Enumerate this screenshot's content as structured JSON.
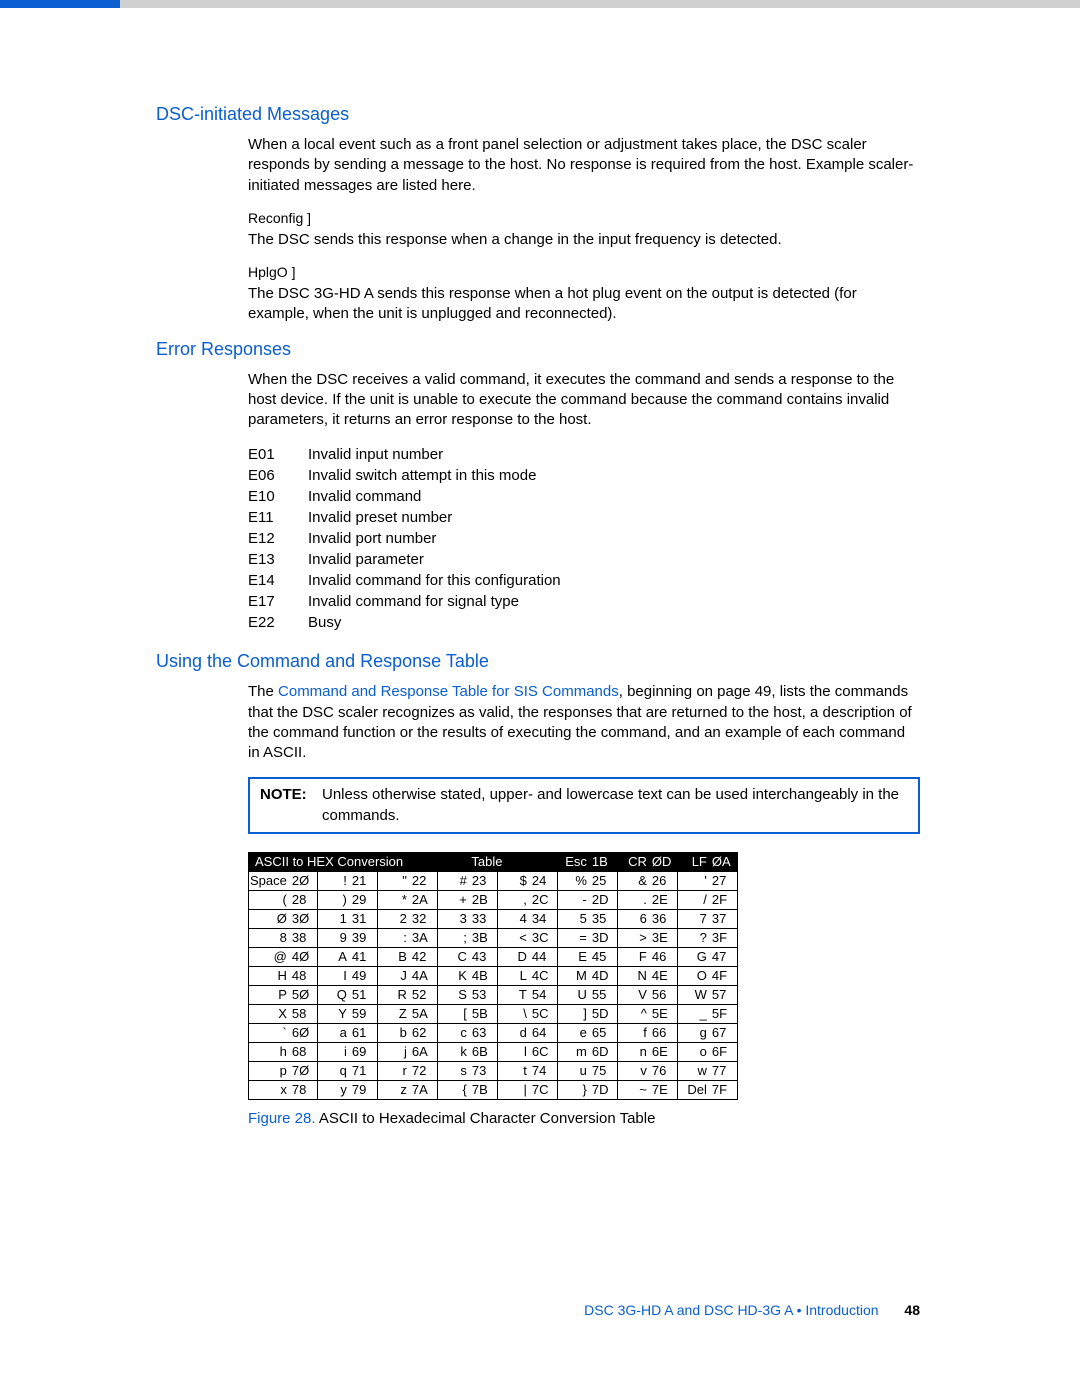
{
  "sections": {
    "dsc": {
      "heading": "DSC-initiated Messages",
      "intro": "When a local event such as a front panel selection or adjustment takes place, the DSC scaler responds by sending a message to the host. No response is required from the host. Example scaler-initiated messages are listed here.",
      "reconfig_label": "Reconfig ]",
      "reconfig_desc": "The DSC sends this response when a change in the input frequency is detected.",
      "hplg_label": "HplgO ]",
      "hplg_desc": "The DSC 3G-HD A sends this response when a hot plug event on the output is detected (for example, when the unit is unplugged and reconnected)."
    },
    "errors": {
      "heading": "Error Responses",
      "intro": "When the DSC receives a valid command, it executes the command and sends a response to the host device. If the unit is unable to execute the command because the command contains invalid parameters, it returns an error response to the host.",
      "codes": [
        {
          "c": "E01",
          "d": "Invalid input number"
        },
        {
          "c": "E06",
          "d": "Invalid switch attempt in this mode"
        },
        {
          "c": "E10",
          "d": "Invalid command"
        },
        {
          "c": "E11",
          "d": "Invalid preset number"
        },
        {
          "c": "E12",
          "d": "Invalid port number"
        },
        {
          "c": "E13",
          "d": "Invalid parameter"
        },
        {
          "c": "E14",
          "d": "Invalid command for this configuration"
        },
        {
          "c": "E17",
          "d": "Invalid command for signal type"
        },
        {
          "c": "E22",
          "d": "Busy"
        }
      ]
    },
    "using": {
      "heading": "Using the Command and Response Table",
      "intro_prefix": "The ",
      "intro_link": "Command and Response Table for SIS Commands",
      "intro_suffix": ", beginning on page 49, lists the commands that the DSC scaler recognizes as valid, the responses that are returned to the host, a description of the command function or the results of executing the command, and an example of each command in ASCII.",
      "note_label": "NOTE:",
      "note_text": "Unless otherwise stated, upper- and lowercase text can be used interchangeably in the commands."
    }
  },
  "chart_data": {
    "type": "table",
    "title": "ASCII to HEX Conversion Table",
    "header_left": "ASCII to HEX Conversion",
    "header_right": "Table",
    "header_suffix": [
      [
        "Esc",
        "1B"
      ],
      [
        "CR",
        "ØD"
      ],
      [
        "LF",
        "ØA"
      ]
    ],
    "rows": [
      [
        [
          "Space",
          "2Ø"
        ],
        [
          "!",
          "21"
        ],
        [
          "\"",
          "22"
        ],
        [
          "#",
          "23"
        ],
        [
          "$",
          "24"
        ],
        [
          "%",
          "25"
        ],
        [
          "&",
          "26"
        ],
        [
          "'",
          "27"
        ]
      ],
      [
        [
          "(",
          "28"
        ],
        [
          ")",
          "29"
        ],
        [
          "*",
          "2A"
        ],
        [
          "+",
          "2B"
        ],
        [
          ",",
          "2C"
        ],
        [
          "-",
          "2D"
        ],
        [
          ".",
          "2E"
        ],
        [
          "/",
          "2F"
        ]
      ],
      [
        [
          "Ø",
          "3Ø"
        ],
        [
          "1",
          "31"
        ],
        [
          "2",
          "32"
        ],
        [
          "3",
          "33"
        ],
        [
          "4",
          "34"
        ],
        [
          "5",
          "35"
        ],
        [
          "6",
          "36"
        ],
        [
          "7",
          "37"
        ]
      ],
      [
        [
          "8",
          "38"
        ],
        [
          "9",
          "39"
        ],
        [
          ":",
          "3A"
        ],
        [
          ";",
          "3B"
        ],
        [
          "<",
          "3C"
        ],
        [
          "=",
          "3D"
        ],
        [
          ">",
          "3E"
        ],
        [
          "?",
          "3F"
        ]
      ],
      [
        [
          "@",
          "4Ø"
        ],
        [
          "A",
          "41"
        ],
        [
          "B",
          "42"
        ],
        [
          "C",
          "43"
        ],
        [
          "D",
          "44"
        ],
        [
          "E",
          "45"
        ],
        [
          "F",
          "46"
        ],
        [
          "G",
          "47"
        ]
      ],
      [
        [
          "H",
          "48"
        ],
        [
          "I",
          "49"
        ],
        [
          "J",
          "4A"
        ],
        [
          "K",
          "4B"
        ],
        [
          "L",
          "4C"
        ],
        [
          "M",
          "4D"
        ],
        [
          "N",
          "4E"
        ],
        [
          "O",
          "4F"
        ]
      ],
      [
        [
          "P",
          "5Ø"
        ],
        [
          "Q",
          "51"
        ],
        [
          "R",
          "52"
        ],
        [
          "S",
          "53"
        ],
        [
          "T",
          "54"
        ],
        [
          "U",
          "55"
        ],
        [
          "V",
          "56"
        ],
        [
          "W",
          "57"
        ]
      ],
      [
        [
          "X",
          "58"
        ],
        [
          "Y",
          "59"
        ],
        [
          "Z",
          "5A"
        ],
        [
          "[",
          "5B"
        ],
        [
          "\\",
          "5C"
        ],
        [
          "]",
          "5D"
        ],
        [
          "^",
          "5E"
        ],
        [
          "_",
          "5F"
        ]
      ],
      [
        [
          "`",
          "6Ø"
        ],
        [
          "a",
          "61"
        ],
        [
          "b",
          "62"
        ],
        [
          "c",
          "63"
        ],
        [
          "d",
          "64"
        ],
        [
          "e",
          "65"
        ],
        [
          "f",
          "66"
        ],
        [
          "g",
          "67"
        ]
      ],
      [
        [
          "h",
          "68"
        ],
        [
          "i",
          "69"
        ],
        [
          "j",
          "6A"
        ],
        [
          "k",
          "6B"
        ],
        [
          "l",
          "6C"
        ],
        [
          "m",
          "6D"
        ],
        [
          "n",
          "6E"
        ],
        [
          "o",
          "6F"
        ]
      ],
      [
        [
          "p",
          "7Ø"
        ],
        [
          "q",
          "71"
        ],
        [
          "r",
          "72"
        ],
        [
          "s",
          "73"
        ],
        [
          "t",
          "74"
        ],
        [
          "u",
          "75"
        ],
        [
          "v",
          "76"
        ],
        [
          "w",
          "77"
        ]
      ],
      [
        [
          "x",
          "78"
        ],
        [
          "y",
          "79"
        ],
        [
          "z",
          "7A"
        ],
        [
          "{",
          "7B"
        ],
        [
          "|",
          "7C"
        ],
        [
          "}",
          "7D"
        ],
        [
          "~",
          "7E"
        ],
        [
          "Del",
          "7F"
        ]
      ]
    ]
  },
  "figure": {
    "number": "Figure 28.",
    "caption": "ASCII to Hexadecimal Character Conversion Table"
  },
  "footer": {
    "doc": "DSC 3G-HD A and DSC HD-3G A • Introduction",
    "page": "48"
  }
}
